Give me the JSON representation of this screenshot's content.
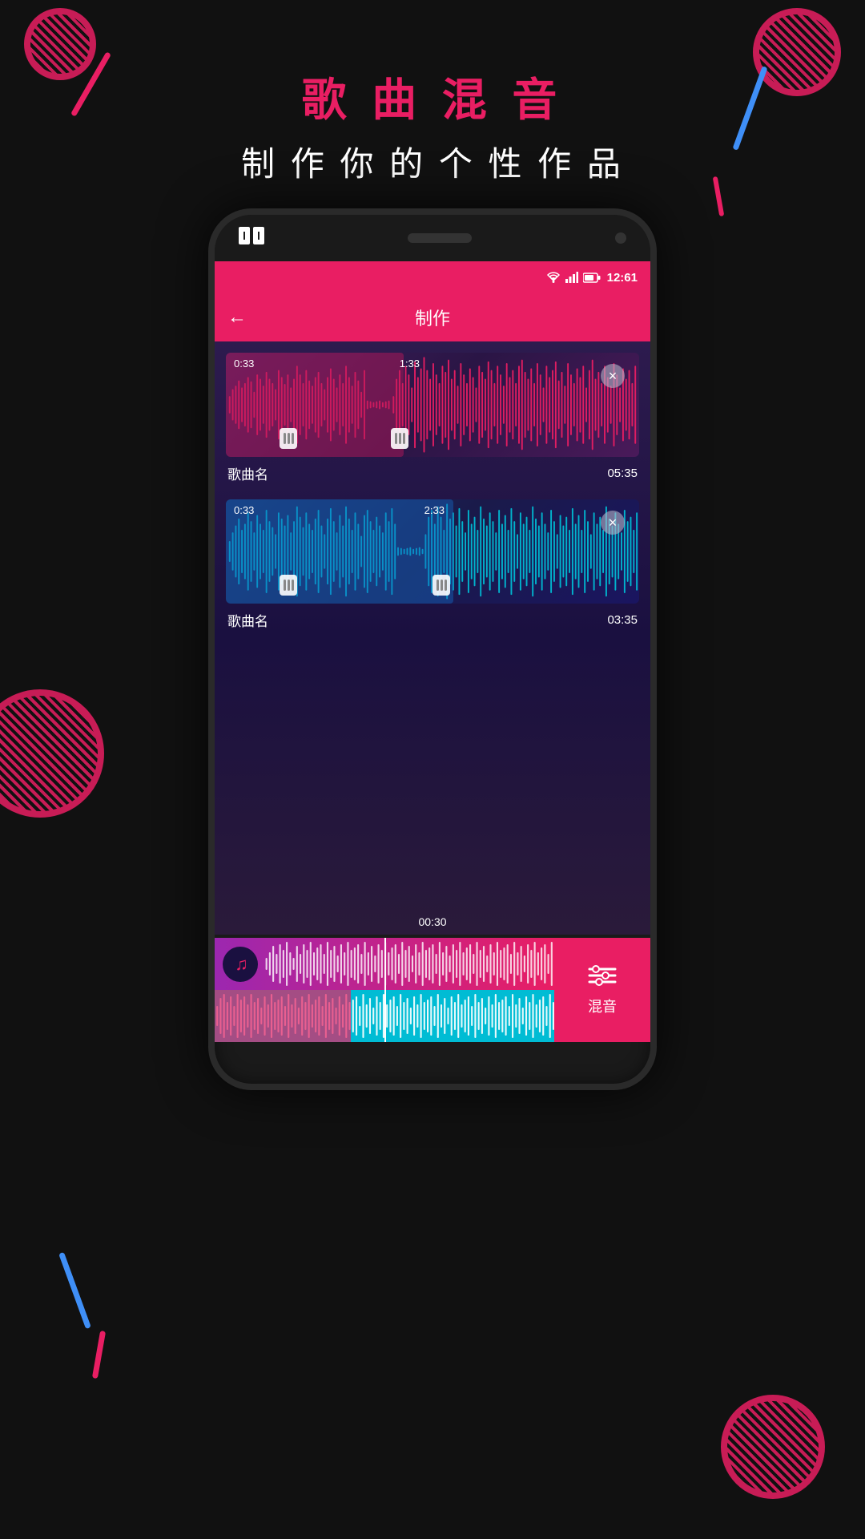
{
  "background": {
    "color": "#111"
  },
  "title": {
    "main": "歌 曲 混 音",
    "sub": "制 作 你 的 个 性 作 品"
  },
  "phone": {
    "brand": "mi",
    "status": {
      "wifi_icon": "wifi",
      "signal_icon": "signal",
      "battery_icon": "battery",
      "time": "12:61"
    },
    "nav": {
      "back_label": "←",
      "title": "制作"
    },
    "track1": {
      "name": "歌曲名",
      "duration": "05:35",
      "time_start": "0:33",
      "time_mid": "1:33",
      "color": "pink"
    },
    "track2": {
      "name": "歌曲名",
      "duration": "03:35",
      "time_start": "0:33",
      "time_mid": "2:33",
      "color": "cyan"
    },
    "playback": {
      "time": "00:30"
    },
    "mix_button": {
      "label": "混音",
      "icon": "sliders"
    }
  }
}
